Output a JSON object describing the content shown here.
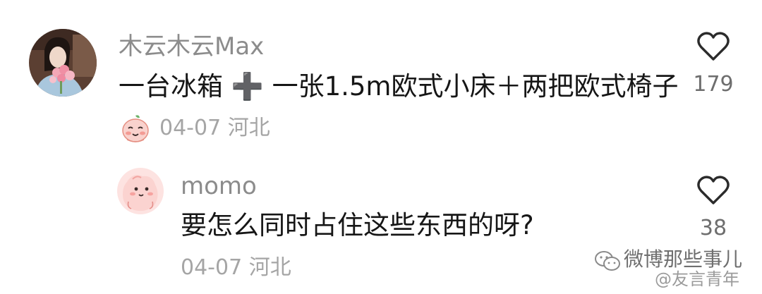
{
  "comments": [
    {
      "username": "木云木云Max",
      "text": "一台冰箱 ➕ 一张1.5m欧式小床＋两把欧式椅子",
      "date_location": "04-07 河北",
      "likes": "179",
      "badge_icon": "peach-sticker-icon"
    },
    {
      "username": "momo",
      "text": "要怎么同时占住这些东西的呀?",
      "date_location": "04-07 河北",
      "likes": "38"
    }
  ],
  "watermark": {
    "line1": "微博那些事儿",
    "line2": "@友言青年"
  },
  "colors": {
    "username": "#8c8c8c",
    "text": "#161616",
    "meta": "#a5a5a5",
    "like_count": "#6e6e6e",
    "peach": "#f9d2cd"
  }
}
